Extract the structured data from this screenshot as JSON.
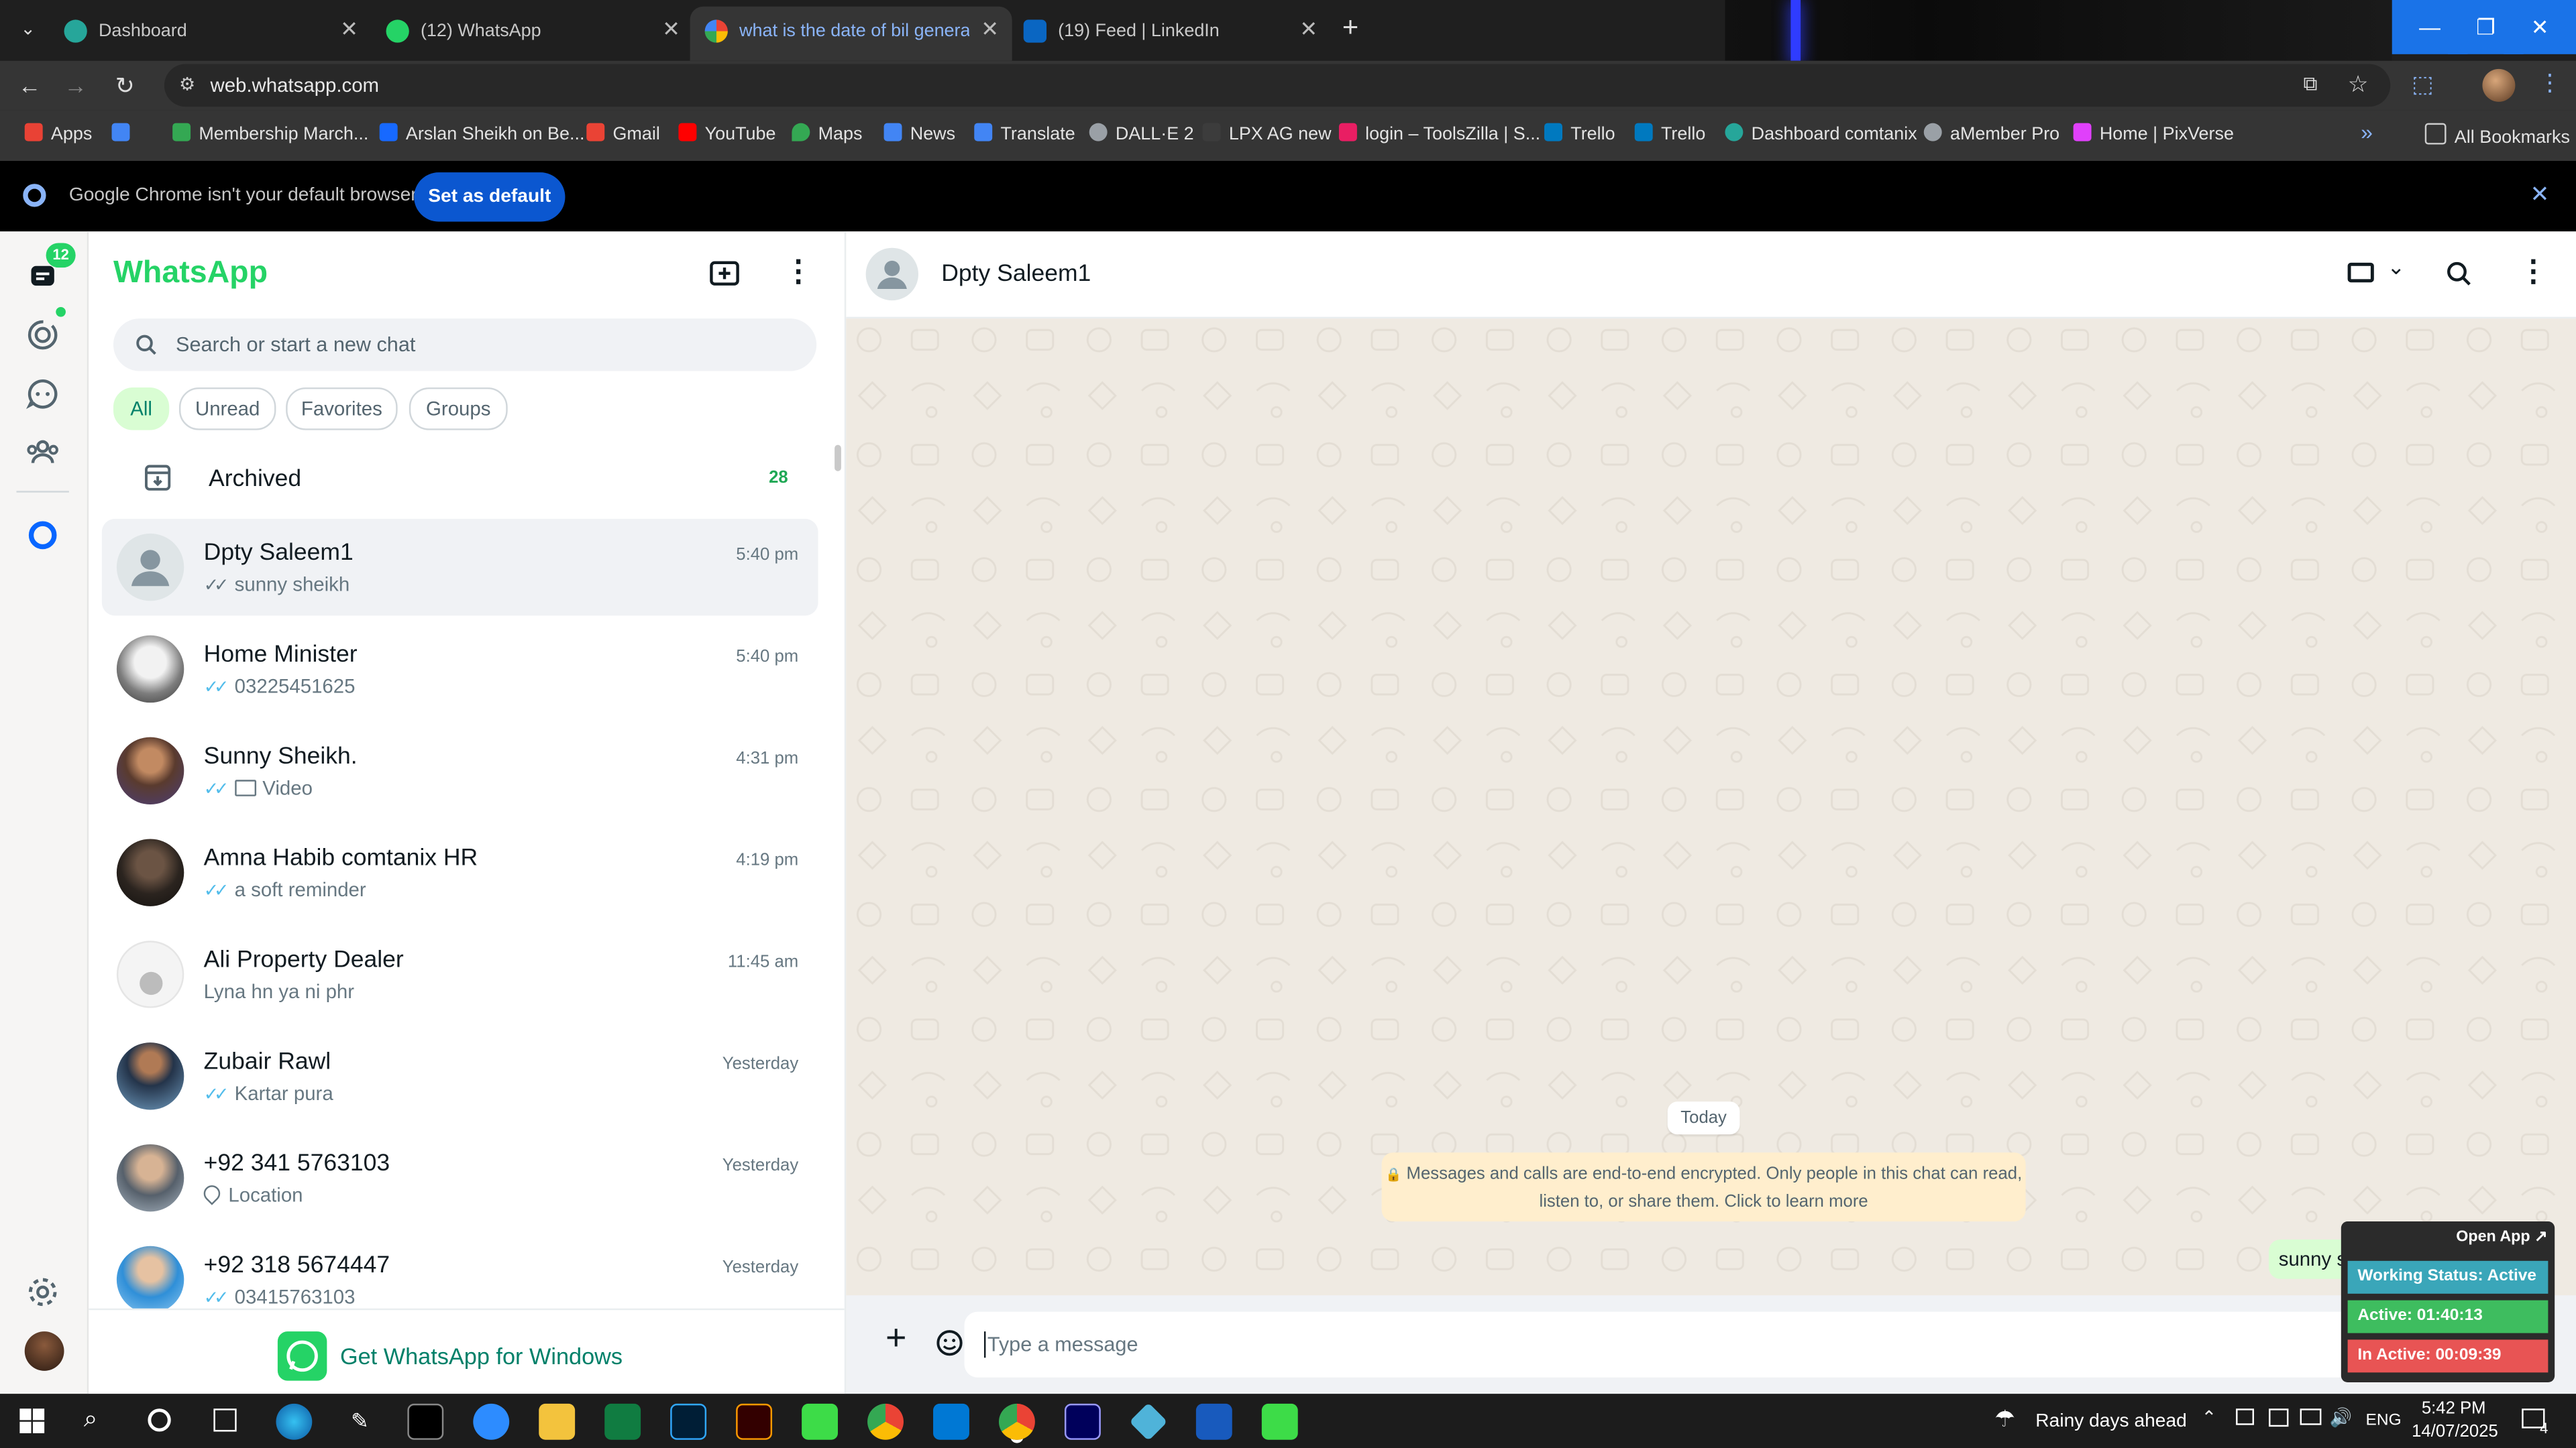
{
  "browser": {
    "tabs": [
      {
        "title": "Dashboard",
        "active": false
      },
      {
        "title": "(12) WhatsApp",
        "active": false
      },
      {
        "title": "what is the date of bil generatio",
        "active": true
      },
      {
        "title": "(19) Feed | LinkedIn",
        "active": false
      }
    ],
    "new_tab": "+",
    "url": "web.whatsapp.com",
    "bookmarks": [
      {
        "label": "Apps",
        "color": "#e94235"
      },
      {
        "label": "",
        "color": "#4285f4"
      },
      {
        "label": "Membership March...",
        "color": "#34a853"
      },
      {
        "label": "Arslan Sheikh on Be...",
        "color": "#1769ff"
      },
      {
        "label": "Gmail",
        "color": "#ea4335"
      },
      {
        "label": "YouTube",
        "color": "#ff0000"
      },
      {
        "label": "Maps",
        "color": "#34a853"
      },
      {
        "label": "News",
        "color": "#4285f4"
      },
      {
        "label": "Translate",
        "color": "#4285f4"
      },
      {
        "label": "DALL·E 2",
        "color": "#9aa0a6"
      },
      {
        "label": "LPX AG new",
        "color": "#3c3c3c"
      },
      {
        "label": "login – ToolsZilla | S...",
        "color": "#e91e63"
      },
      {
        "label": "Trello",
        "color": "#0079bf"
      },
      {
        "label": "Trello",
        "color": "#0079bf"
      },
      {
        "label": "Dashboard comtanix",
        "color": "#26a69a"
      },
      {
        "label": "aMember Pro",
        "color": "#9aa0a6"
      },
      {
        "label": "Home | PixVerse",
        "color": "#e040fb"
      }
    ],
    "more_bookmarks": "»",
    "all_bookmarks": "All Bookmarks",
    "infobar_text": "Google Chrome isn't your default browser",
    "infobar_button": "Set as default"
  },
  "rail": {
    "unread_badge": "12"
  },
  "sidebar": {
    "title": "WhatsApp",
    "search_placeholder": "Search or start a new chat",
    "filters": [
      "All",
      "Unread",
      "Favorites",
      "Groups"
    ],
    "archived_label": "Archived",
    "archived_count": "28",
    "chats": [
      {
        "name": "Dpty Saleem1",
        "preview": "sunny sheikh",
        "time": "5:40 pm",
        "tick": true,
        "avatar": "default",
        "selected": true
      },
      {
        "name": "Home Minister",
        "preview": "03225451625",
        "time": "5:40 pm",
        "tick": true,
        "avatar": "#9e9e9e"
      },
      {
        "name": "Sunny Sheikh.",
        "preview": "Video",
        "time": "4:31 pm",
        "tick": true,
        "avatar": "#6d5a8a",
        "icon": "video"
      },
      {
        "name": "Amna Habib comtanix HR",
        "preview": "a soft reminder",
        "time": "4:19 pm",
        "tick": true,
        "avatar": "#2e2a25"
      },
      {
        "name": "Ali Property Dealer",
        "preview": "Lyna hn ya ni phr",
        "time": "11:45 am",
        "tick": false,
        "avatar": "#d8d8d8"
      },
      {
        "name": "Zubair Rawl",
        "preview": "Kartar pura",
        "time": "Yesterday",
        "tick": true,
        "avatar": "#3e6b8c"
      },
      {
        "name": "+92 341 5763103",
        "preview": "Location",
        "time": "Yesterday",
        "tick": false,
        "avatar": "#7a8c9b",
        "icon": "location"
      },
      {
        "name": "+92 318 5674447",
        "preview": "03415763103",
        "time": "Yesterday",
        "tick": true,
        "avatar": "#2f8fd8"
      }
    ],
    "get_windows": "Get WhatsApp for Windows"
  },
  "conversation": {
    "contact": "Dpty Saleem1",
    "date_chip": "Today",
    "encryption_notice": "Messages and calls are end-to-end encrypted. Only people in this chat can read, listen to, or share them. Click to learn more",
    "outgoing_message": "sunny sheikh",
    "composer_placeholder": "Type a message"
  },
  "widget": {
    "open_app": "Open App ↗",
    "working_status": "Working Status: Active",
    "active": "Active: 01:40:13",
    "inactive": "In Active: 00:09:39",
    "colors": {
      "status": "#3aa6b9",
      "active": "#3ebd5f",
      "inactive": "#e85454"
    }
  },
  "taskbar": {
    "weather": "Rainy days ahead",
    "language": "ENG",
    "time": "5:42 PM",
    "date": "14/07/2025",
    "notifications": "4"
  }
}
